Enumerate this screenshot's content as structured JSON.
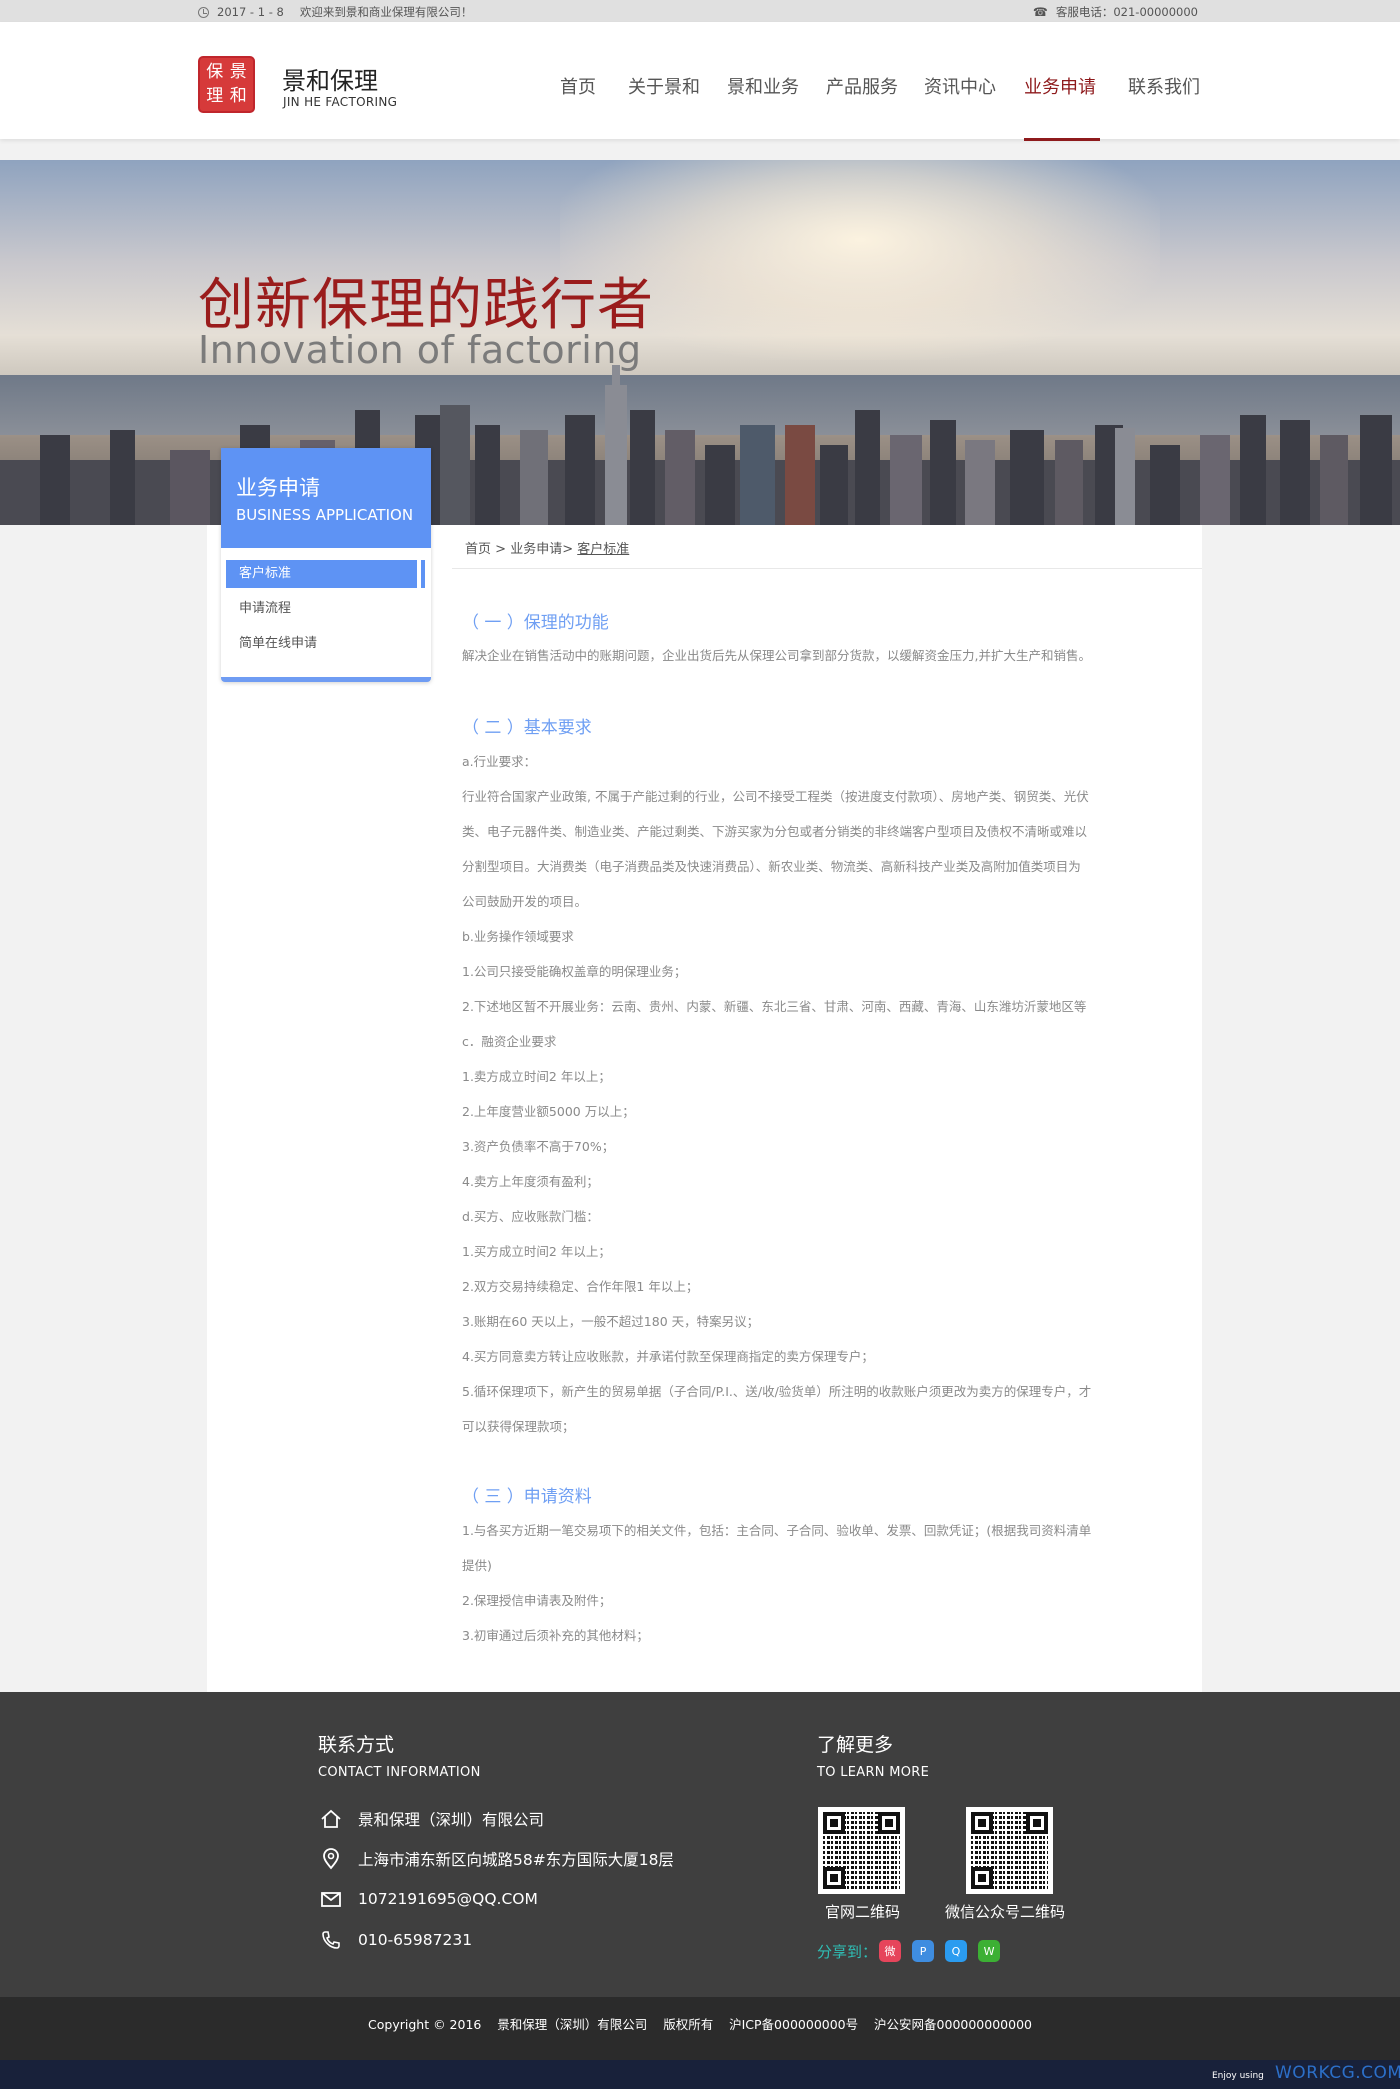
{
  "topbar": {
    "date": "2017 - 1 - 8",
    "welcome": "欢迎来到景和商业保理有限公司！",
    "phone": "客服电话：021-00000000"
  },
  "logo": {
    "seal_chars": [
      "保",
      "景",
      "理",
      "和"
    ],
    "name_cn": "景和保理",
    "name_en": "JIN HE FACTORING"
  },
  "nav": {
    "items": [
      "首页",
      "关于景和",
      "景和业务",
      "产品服务",
      "资讯中心",
      "业务申请",
      "联系我们"
    ],
    "active": "业务申请"
  },
  "banner": {
    "title_cn": "创新保理的践行者",
    "title_en": "Innovation of factoring"
  },
  "sidebar": {
    "title_cn": "业务申请",
    "title_en": "BUSINESS APPLICATION",
    "items": [
      "客户标准",
      "申请流程",
      "简单在线申请"
    ],
    "active": "客户标准"
  },
  "breadcrumb": {
    "home": "首页",
    "sep": " > ",
    "section": "业务申请",
    "sep2": "> ",
    "current": "客户标准"
  },
  "content": {
    "sec1_title": "（ 一 ）保理的功能",
    "sec1_text": "解决企业在销售活动中的账期问题，企业出货后先从保理公司拿到部分货款，以缓解资金压力,并扩大生产和销售。",
    "sec2_title": "（ 二 ）基本要求",
    "sec2_lines": [
      "a.行业要求：",
      "行业符合国家产业政策, 不属于产能过剩的行业，公司不接受工程类（按进度支付款项）、房地产类、钢贸类、光伏",
      "类、电子元器件类、制造业类、产能过剩类、下游买家为分包或者分销类的非终端客户型项目及债权不清晰或难以",
      "分割型项目。大消费类（电子消费品类及快速消费品）、新农业类、物流类、高新科技产业类及高附加值类项目为",
      "公司鼓励开发的项目。",
      "b.业务操作领域要求",
      "1.公司只接受能确权盖章的明保理业务；",
      "2.下述地区暂不开展业务：云南、贵州、内蒙、新疆、东北三省、甘肃、河南、西藏、青海、山东潍坊沂蒙地区等",
      " c．融资企业要求",
      "1.卖方成立时间2 年以上；",
      "2.上年度营业额5000 万以上；",
      "3.资产负债率不高于70%；",
      "4.卖方上年度须有盈利；",
      "d.买方、应收账款门槛：",
      "1.买方成立时间2 年以上；",
      "2.双方交易持续稳定、合作年限1 年以上；",
      "3.账期在60 天以上，一般不超过180 天，特案另议；",
      "4.买方同意卖方转让应收账款，并承诺付款至保理商指定的卖方保理专户；",
      "5.循环保理项下，新产生的贸易单据（子合同/P.I.、送/收/验货单）所注明的收款账户须更改为卖方的保理专户，才",
      "可以获得保理款项；"
    ],
    "sec3_title": "（ 三 ）申请资料",
    "sec3_lines": [
      "1.与各买方近期一笔交易项下的相关文件，包括：主合同、子合同、验收单、发票、回款凭证；(根据我司资料清单",
      "提供)",
      "2.保理授信申请表及附件；",
      "3.初审通过后须补充的其他材料；"
    ]
  },
  "footer": {
    "contact_title": "联系方式",
    "contact_sub": "CONTACT INFORMATION",
    "company": "景和保理（深圳）有限公司",
    "address": "上海市浦东新区向城路58#东方国际大厦18层",
    "email": "1072191695@QQ.COM",
    "phone": "010-65987231",
    "more_title": "了解更多",
    "more_sub": "TO LEARN MORE",
    "qr1": "官网二维码",
    "qr2": "微信公众号二维码",
    "share_label": "分享到："
  },
  "copyright": {
    "text": "Copyright © 2016",
    "company": "景和保理（深圳）有限公司",
    "rights": "版权所有",
    "icp": "沪ICP备000000000号",
    "police": "沪公安网备000000000000"
  },
  "bottom": {
    "enjoy": "Enjoy using",
    "brand": "WORKCG.COM"
  },
  "colors": {
    "brand_red": "#8e1a1c",
    "accent_blue": "#5e93f4",
    "footer_bg": "#3f3f3f"
  }
}
